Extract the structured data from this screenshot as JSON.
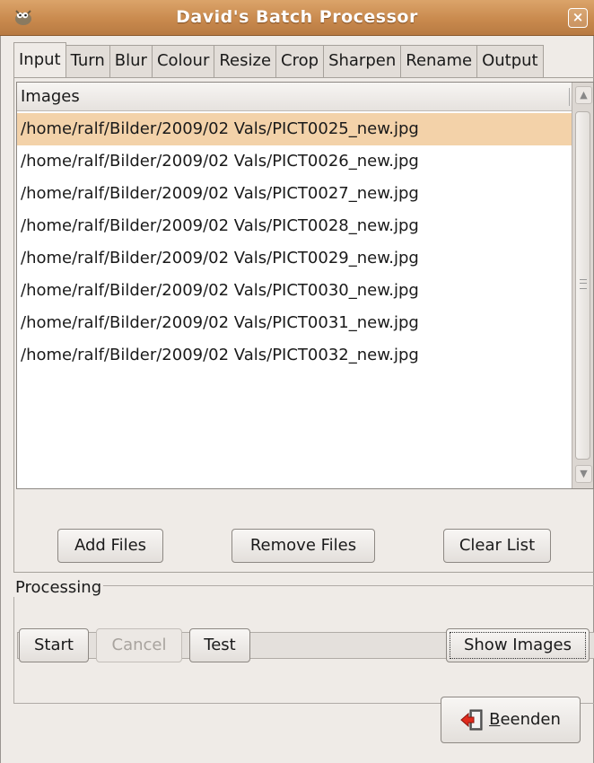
{
  "window": {
    "title": "David's Batch Processor",
    "close_glyph": "×",
    "app_icon": "gimp-wilber-icon",
    "colors": {
      "titlebar": "#c98a4e",
      "selection": "#f3d2a9",
      "background": "#efebe7"
    }
  },
  "tabs": [
    {
      "label": "Input",
      "active": true
    },
    {
      "label": "Turn"
    },
    {
      "label": "Blur"
    },
    {
      "label": "Colour"
    },
    {
      "label": "Resize"
    },
    {
      "label": "Crop"
    },
    {
      "label": "Sharpen"
    },
    {
      "label": "Rename"
    },
    {
      "label": "Output"
    }
  ],
  "images": {
    "column_header": "Images",
    "files": [
      "/home/ralf/Bilder/2009/02 Vals/PICT0025_new.jpg",
      "/home/ralf/Bilder/2009/02 Vals/PICT0026_new.jpg",
      "/home/ralf/Bilder/2009/02 Vals/PICT0027_new.jpg",
      "/home/ralf/Bilder/2009/02 Vals/PICT0028_new.jpg",
      "/home/ralf/Bilder/2009/02 Vals/PICT0029_new.jpg",
      "/home/ralf/Bilder/2009/02 Vals/PICT0030_new.jpg",
      "/home/ralf/Bilder/2009/02 Vals/PICT0031_new.jpg",
      "/home/ralf/Bilder/2009/02 Vals/PICT0032_new.jpg"
    ],
    "selected_index": 0
  },
  "list_buttons": {
    "add": "Add Files",
    "remove": "Remove Files",
    "clear": "Clear List"
  },
  "processing": {
    "label": "Processing",
    "progress": 0,
    "start": "Start",
    "cancel": "Cancel",
    "test": "Test",
    "show_images": "Show Images"
  },
  "quit": {
    "mnemonic": "B",
    "rest": "eenden",
    "icon": "exit-door-icon"
  }
}
